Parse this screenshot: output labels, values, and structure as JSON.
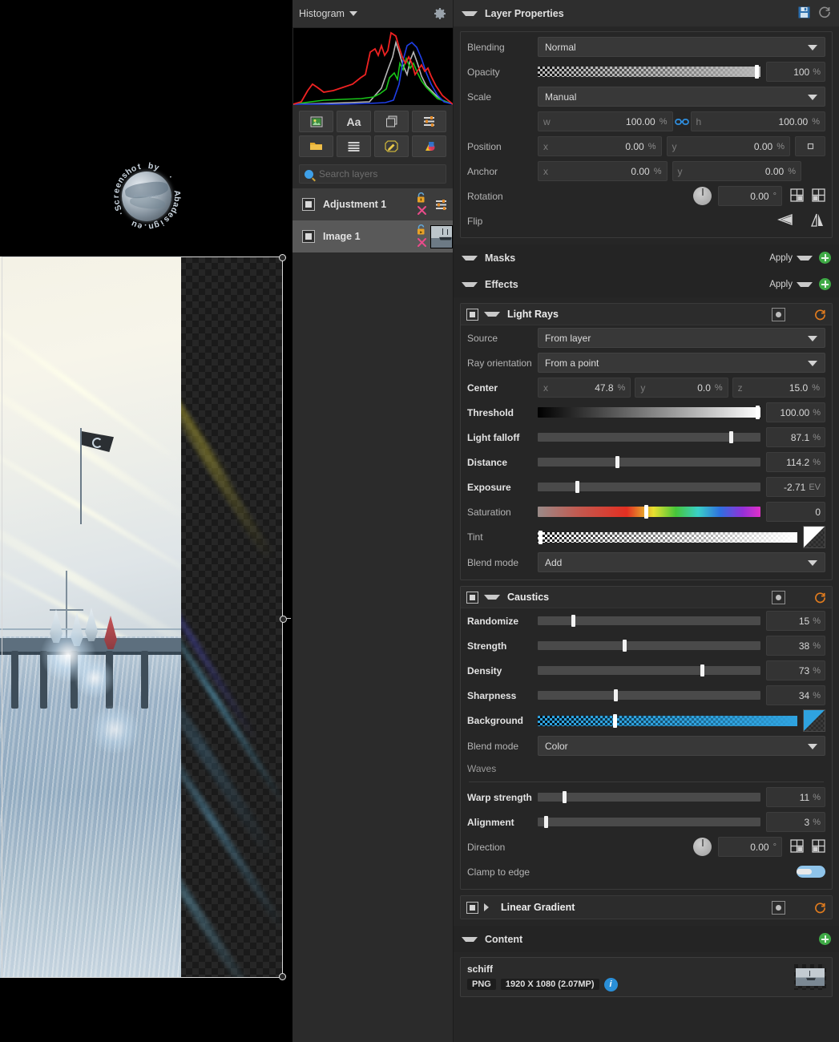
{
  "histogram_panel": {
    "title": "Histogram",
    "caret_icon": "chevron-down-icon",
    "gear_icon": "gear-icon",
    "toolbar_buttons": [
      {
        "name": "image-layer-button",
        "icon": "image-icon"
      },
      {
        "name": "text-layer-button",
        "icon": "text-aa-icon",
        "label": "Aa"
      },
      {
        "name": "duplicate-layer-button",
        "icon": "copy-icon"
      },
      {
        "name": "adjustment-layer-button",
        "icon": "sliders-icon"
      },
      {
        "name": "group-layer-button",
        "icon": "folder-icon"
      },
      {
        "name": "list-layer-button",
        "icon": "list-icon"
      },
      {
        "name": "edit-layer-button",
        "icon": "pencil-icon"
      },
      {
        "name": "fill-layer-button",
        "icon": "color-shapes-icon"
      }
    ],
    "search_placeholder": "Search layers",
    "search_value": "",
    "layers": [
      {
        "name": "Adjustment 1",
        "selected": false,
        "visible": true,
        "has_thumb": false
      },
      {
        "name": "Image 1",
        "selected": true,
        "visible": true,
        "has_thumb": true
      }
    ]
  },
  "layer_properties": {
    "title": "Layer Properties",
    "save_icon": "save-disk-icon",
    "reset_icon": "reset-circle-icon",
    "blending": {
      "label": "Blending",
      "value": "Normal"
    },
    "opacity": {
      "label": "Opacity",
      "value": "100",
      "unit": "%",
      "percent": 100
    },
    "scale": {
      "label": "Scale",
      "value": "Manual"
    },
    "scale_w": {
      "key": "w",
      "value": "100.00",
      "unit": "%"
    },
    "scale_h": {
      "key": "h",
      "value": "100.00",
      "unit": "%"
    },
    "link_icon": "link-chain-icon",
    "position": {
      "label": "Position",
      "x_key": "x",
      "x": "0.00",
      "y_key": "y",
      "y": "0.00",
      "unit": "%"
    },
    "anchor": {
      "label": "Anchor",
      "x_key": "x",
      "x": "0.00",
      "y_key": "y",
      "y": "0.00",
      "unit": "%"
    },
    "rotation": {
      "label": "Rotation",
      "value": "0.00",
      "unit": "°",
      "rotate_left_icon": "rotate-ccw-icon",
      "rotate_right_icon": "rotate-cw-icon"
    },
    "flip": {
      "label": "Flip",
      "flip_h_icon": "flip-horizontal-icon",
      "flip_v_icon": "flip-vertical-icon"
    },
    "position_reset_icon": "center-square-icon"
  },
  "masks": {
    "title": "Masks",
    "apply_label": "Apply",
    "add_icon": "plus-circle-icon"
  },
  "effects_header": {
    "title": "Effects",
    "apply_label": "Apply",
    "add_icon": "plus-circle-icon"
  },
  "light_rays": {
    "title": "Light Rays",
    "expanded": true,
    "icons": [
      "preview-icon",
      "menu-icon",
      "reset-icon"
    ],
    "source": {
      "label": "Source",
      "value": "From layer"
    },
    "ray_orientation": {
      "label": "Ray orientation",
      "value": "From a point"
    },
    "center": {
      "label": "Center",
      "x_key": "x",
      "x": "47.8",
      "y_key": "y",
      "y": "0.0",
      "z_key": "z",
      "z": "15.0",
      "unit": "%"
    },
    "threshold": {
      "label": "Threshold",
      "value": "100.00",
      "unit": "%",
      "percent": 100
    },
    "light_falloff": {
      "label": "Light falloff",
      "value": "87.1",
      "unit": "%",
      "percent": 87.1
    },
    "distance": {
      "label": "Distance",
      "value": "114.2",
      "unit": "%",
      "percent": 35
    },
    "exposure": {
      "label": "Exposure",
      "value": "-2.71",
      "unit": "EV",
      "percent": 17
    },
    "saturation": {
      "label": "Saturation",
      "value": "0",
      "unit": "",
      "percent": 48
    },
    "tint": {
      "label": "Tint",
      "percent": 1,
      "swatch": "#ffffff"
    },
    "blend_mode": {
      "label": "Blend mode",
      "value": "Add"
    }
  },
  "caustics": {
    "title": "Caustics",
    "expanded": true,
    "icons": [
      "preview-icon",
      "menu-icon",
      "reset-icon"
    ],
    "randomize": {
      "label": "Randomize",
      "value": "15",
      "unit": "%",
      "percent": 15
    },
    "strength": {
      "label": "Strength",
      "value": "38",
      "unit": "%",
      "percent": 38
    },
    "density": {
      "label": "Density",
      "value": "73",
      "unit": "%",
      "percent": 73
    },
    "sharpness": {
      "label": "Sharpness",
      "value": "34",
      "unit": "%",
      "percent": 34
    },
    "background": {
      "label": "Background",
      "percent": 30,
      "swatch": "#2fa3e0"
    },
    "blend_mode": {
      "label": "Blend mode",
      "value": "Color"
    },
    "waves_label": "Waves",
    "warp_strength": {
      "label": "Warp strength",
      "value": "11",
      "unit": "%",
      "percent": 11
    },
    "alignment": {
      "label": "Alignment",
      "value": "3",
      "unit": "%",
      "percent": 3
    },
    "direction": {
      "label": "Direction",
      "value": "0.00",
      "unit": "°",
      "rotate_left_icon": "rotate-ccw-icon",
      "rotate_right_icon": "rotate-cw-icon"
    },
    "clamp_to_edge": {
      "label": "Clamp to edge",
      "enabled": true
    }
  },
  "linear_gradient": {
    "title": "Linear Gradient",
    "expanded": false,
    "icons": [
      "preview-icon",
      "menu-icon",
      "reset-icon"
    ]
  },
  "content": {
    "title": "Content",
    "add_icon": "plus-circle-icon",
    "item": {
      "name": "schiff",
      "format": "PNG",
      "dimensions": "1920 X 1080 (2.07MP)",
      "info_icon": "info-icon"
    }
  },
  "canvas": {
    "watermark_text": "Screenshot by  ·  Abadesign.eu  ·",
    "watermark_inner": "abadesign.eu",
    "selection_handles": 3
  },
  "colors": {
    "accent_blue": "#2a8fd8",
    "accent_orange": "#e07b1e",
    "accent_green": "#3faa46",
    "panel_bg": "#262626",
    "header_bg": "#2e2e2e"
  }
}
